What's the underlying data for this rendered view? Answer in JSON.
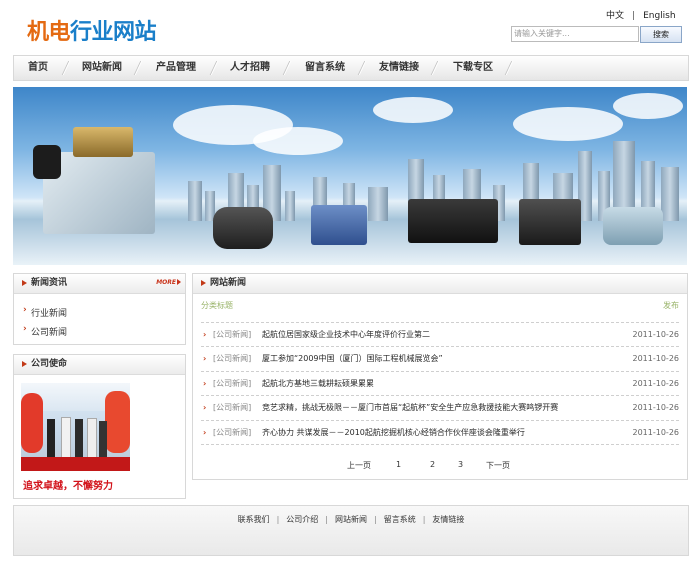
{
  "logo": {
    "part1": "机电",
    "part2": "行业网站"
  },
  "lang": {
    "cn": "中文",
    "sep": "|",
    "en": "English"
  },
  "search": {
    "placeholder": "请输入关键字...",
    "button": "搜索"
  },
  "nav": [
    "首页",
    "网站新闻",
    "产品管理",
    "人才招聘",
    "留言系统",
    "友情链接",
    "下载专区"
  ],
  "news_box": {
    "title": "新闻资讯",
    "more": "MORE",
    "links": [
      "行业新闻",
      "公司新闻"
    ]
  },
  "mission_box": {
    "title": "公司使命",
    "slogan": "追求卓越，不懈努力"
  },
  "main": {
    "title": "网站新闻",
    "col_category": "分类标题",
    "col_date": "发布",
    "rows": [
      {
        "cat": "[公司新闻]",
        "title": "起航位居国家级企业技术中心年度评价行业第二",
        "date": "2011-10-26"
      },
      {
        "cat": "[公司新闻]",
        "title": "厦工参加“2009中国（厦门）国际工程机械展览会”",
        "date": "2011-10-26"
      },
      {
        "cat": "[公司新闻]",
        "title": "起航北方基地三载耕耘硕果累累",
        "date": "2011-10-26"
      },
      {
        "cat": "[公司新闻]",
        "title": "竞艺求精，挑战无极限－－厦门市首届“起航杯”安全生产应急救援技能大赛鸣锣开赛",
        "date": "2011-10-26"
      },
      {
        "cat": "[公司新闻]",
        "title": "齐心协力 共谋发展－－2010起航挖掘机核心经销合作伙伴座谈会隆重举行",
        "date": "2011-10-26"
      }
    ],
    "pager": {
      "prev": "上一页",
      "pages": [
        "1",
        "2",
        "3"
      ],
      "next": "下一页"
    }
  },
  "footer": {
    "links": [
      "联系我们",
      "公司介绍",
      "网站新闻",
      "留言系统",
      "友情链接"
    ],
    "sep": "|"
  },
  "colors": {
    "logo_orange": "#e46a12",
    "logo_blue": "#1a7fc9",
    "accent_red": "#c23a18",
    "slogan_red": "#d2121a"
  }
}
